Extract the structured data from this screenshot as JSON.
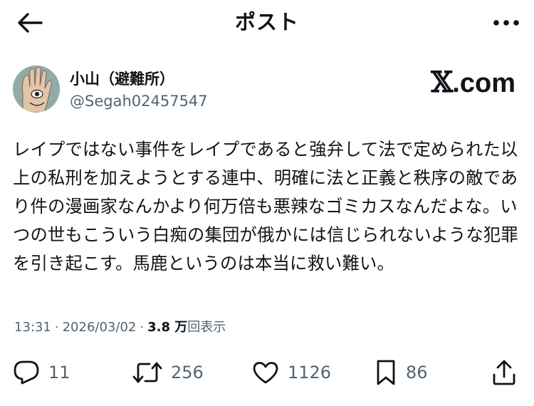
{
  "header": {
    "title": "ポスト",
    "back_icon": "arrow-left-icon",
    "more_icon": "more-horizontal-icon"
  },
  "author": {
    "display_name": "小山（避難所）",
    "handle": "@Segah02457547",
    "avatar_icon": "avatar-image"
  },
  "watermark": {
    "x_letter": "𝕏",
    "domain": ".com"
  },
  "post": {
    "text": "レイプではない事件をレイプであると強弁して法で定められた以上の私刑を加えようとする連中、明確に法と正義と秩序の敵であり件の漫画家なんかより何万倍も悪辣なゴミカスなんだよな。いつの世もこういう白痴の集団が俄かには信じられないような犯罪を引き起こす。馬鹿というのは本当に救い難い。"
  },
  "meta": {
    "time": "13:31",
    "separator": "·",
    "date": "2026/03/02",
    "views_count": "3.8 万",
    "views_label": "回表示"
  },
  "actions": {
    "reply": {
      "icon": "reply-icon",
      "count": "11"
    },
    "retweet": {
      "icon": "retweet-icon",
      "count": "256"
    },
    "like": {
      "icon": "heart-icon",
      "count": "1126"
    },
    "bookmark": {
      "icon": "bookmark-icon",
      "count": "86"
    },
    "share": {
      "icon": "share-icon"
    }
  },
  "colors": {
    "text_primary": "#0f1419",
    "text_secondary": "#536471",
    "background": "#ffffff"
  }
}
